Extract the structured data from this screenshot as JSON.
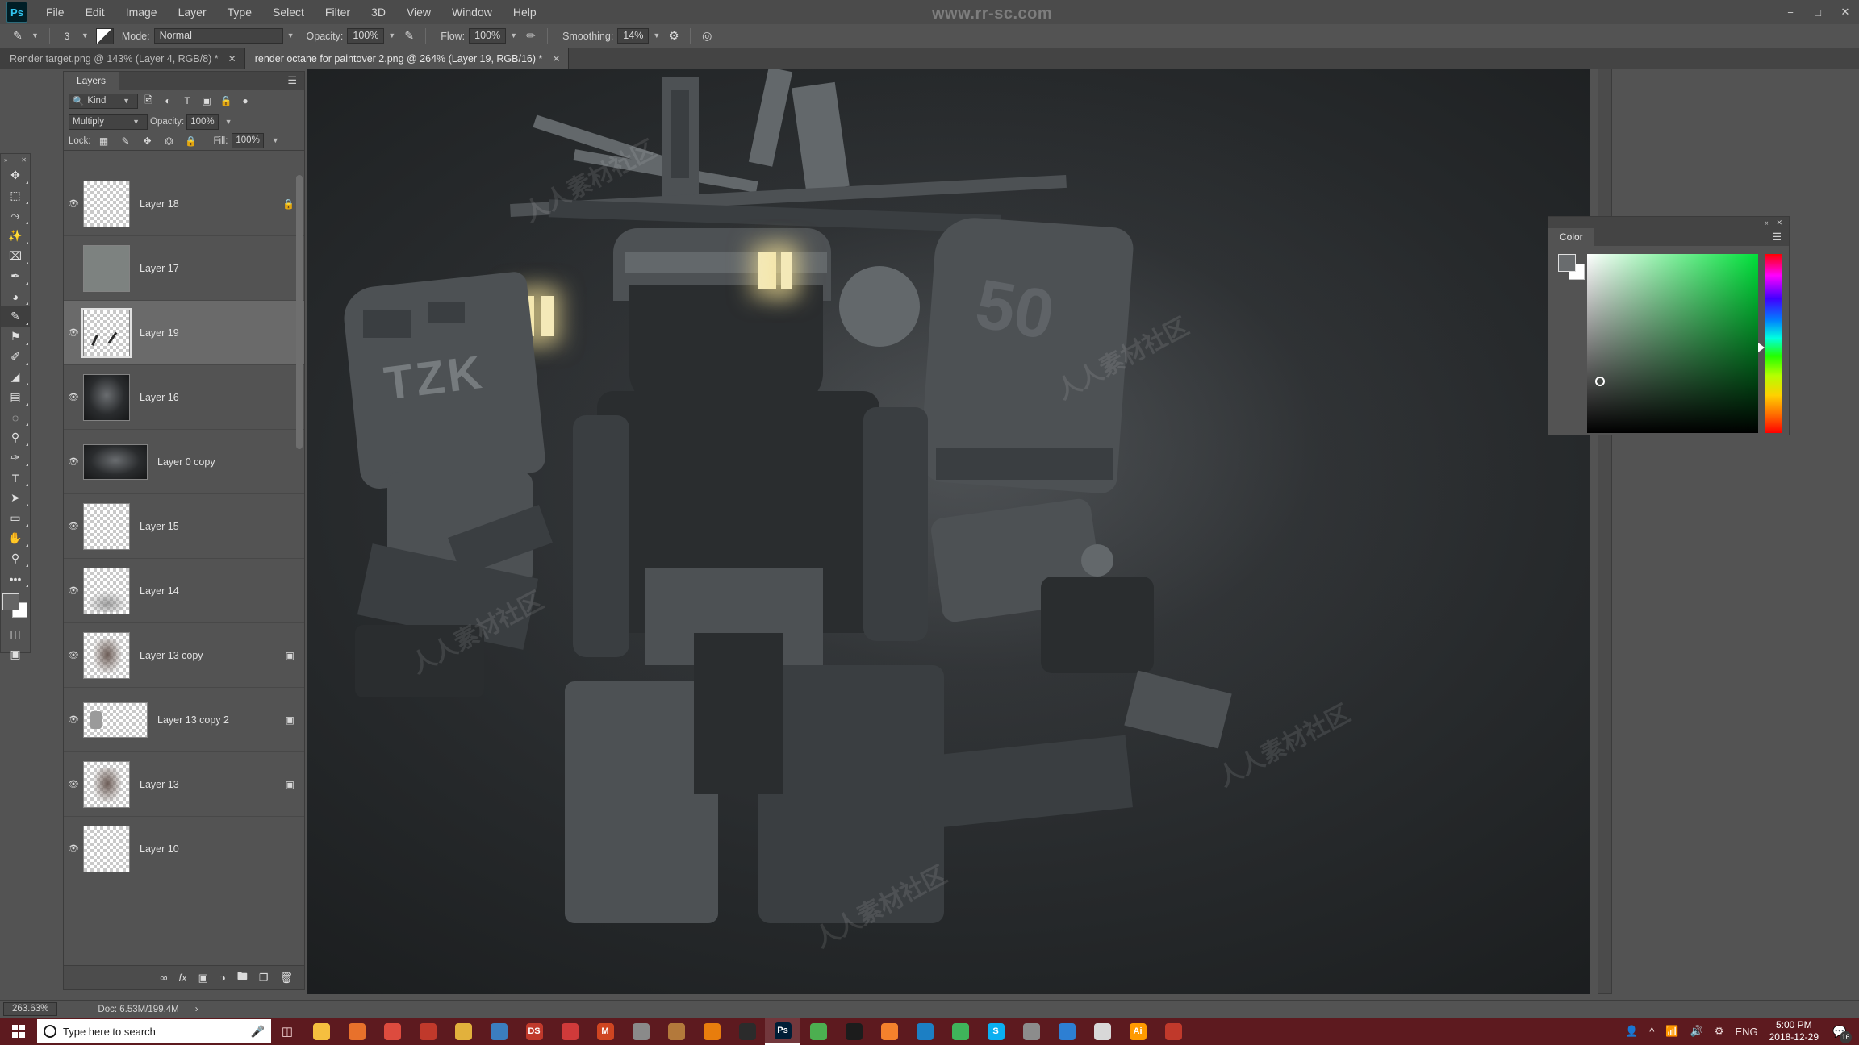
{
  "app": {
    "logo": "Ps",
    "watermark_top": "www.rr-sc.com",
    "watermark_tile": "人人素材社区"
  },
  "menu": {
    "items": [
      "File",
      "Edit",
      "Image",
      "Layer",
      "Type",
      "Select",
      "Filter",
      "3D",
      "View",
      "Window",
      "Help"
    ]
  },
  "window_controls": {
    "minimize": "−",
    "maximize": "□",
    "close": "✕"
  },
  "options_bar": {
    "brush_icon": "brush-icon",
    "brush_size": "3",
    "preset_picker": "brush-preset-swatch",
    "mode_label": "Mode:",
    "mode_value": "Normal",
    "opacity_label": "Opacity:",
    "opacity_value": "100%",
    "airbrush_icon": "airbrush-icon",
    "flow_label": "Flow:",
    "flow_value": "100%",
    "flow_pressure_icon": "pressure-flow-icon",
    "smoothing_label": "Smoothing:",
    "smoothing_value": "14%",
    "smoothing_gear_icon": "gear-icon",
    "symmetry_icon": "symmetry-icon",
    "tablet_pressure_icon": "tablet-pressure-icon"
  },
  "tabs": [
    {
      "label": "Render target.png @ 143% (Layer 4, RGB/8) *",
      "active": false,
      "close": "✕"
    },
    {
      "label": "render octane for paintover 2.png @ 264% (Layer 19, RGB/16) *",
      "active": true,
      "close": "✕"
    }
  ],
  "toolbar": {
    "collapse": "»",
    "close": "✕",
    "tools": [
      {
        "name": "move-tool",
        "glyph": "✥",
        "selected": false
      },
      {
        "name": "rectangular-marquee-tool",
        "glyph": "⬚",
        "selected": false
      },
      {
        "name": "lasso-tool",
        "glyph": "⤳",
        "selected": false
      },
      {
        "name": "magic-wand-tool",
        "glyph": "✨",
        "selected": false
      },
      {
        "name": "crop-tool",
        "glyph": "⌧",
        "selected": false
      },
      {
        "name": "eyedropper-tool",
        "glyph": "✒",
        "selected": false
      },
      {
        "name": "spot-healing-brush-tool",
        "glyph": "◕",
        "selected": false
      },
      {
        "name": "brush-tool",
        "glyph": "✎",
        "selected": true
      },
      {
        "name": "clone-stamp-tool",
        "glyph": "⚑",
        "selected": false
      },
      {
        "name": "history-brush-tool",
        "glyph": "✐",
        "selected": false
      },
      {
        "name": "eraser-tool",
        "glyph": "◢",
        "selected": false
      },
      {
        "name": "gradient-tool",
        "glyph": "▤",
        "selected": false
      },
      {
        "name": "blur-tool",
        "glyph": "◌",
        "selected": false
      },
      {
        "name": "dodge-tool",
        "glyph": "⚲",
        "selected": false
      },
      {
        "name": "pen-tool",
        "glyph": "✑",
        "selected": false
      },
      {
        "name": "type-tool",
        "glyph": "T",
        "selected": false
      },
      {
        "name": "path-selection-tool",
        "glyph": "➤",
        "selected": false
      },
      {
        "name": "rectangle-tool",
        "glyph": "▭",
        "selected": false
      },
      {
        "name": "hand-tool",
        "glyph": "✋",
        "selected": false
      },
      {
        "name": "zoom-tool",
        "glyph": "⚲",
        "selected": false
      },
      {
        "name": "edit-toolbar-button",
        "glyph": "•••",
        "selected": false
      }
    ],
    "quick_mask_icon": "quick-mask-icon",
    "screen_mode_icon": "screen-mode-icon",
    "swap-colors-icon": "swap-colors-icon",
    "default-colors-icon": "default-colors-icon",
    "foreground_color": "#656565",
    "background_color": "#ffffff"
  },
  "layers_panel": {
    "tab_label": "Layers",
    "menu_icon": "panel-menu-icon",
    "filter": {
      "kind_label": "Kind",
      "search_icon": "search-icon",
      "icons": [
        "pixel-filter-icon",
        "adjustment-filter-icon",
        "type-filter-icon",
        "shape-filter-icon",
        "smart-object-filter-icon"
      ],
      "toggle_icon": "filter-toggle-icon"
    },
    "blend_mode": "Multiply",
    "opacity_label": "Opacity:",
    "opacity_value": "100%",
    "lock_label": "Lock:",
    "lock_icons": [
      "lock-transparent-pixels-icon",
      "lock-image-pixels-icon",
      "lock-position-icon",
      "lock-artboard-icon",
      "lock-all-icon"
    ],
    "fill_label": "Fill:",
    "fill_value": "100%",
    "layers": [
      {
        "name": "Layer 18",
        "visible": true,
        "selected": false,
        "thumb": "checker",
        "right_icon": "lock-icon"
      },
      {
        "name": "Layer 17",
        "visible": false,
        "selected": false,
        "thumb": "solid",
        "right_icon": ""
      },
      {
        "name": "Layer 19",
        "visible": true,
        "selected": true,
        "thumb": "strokes",
        "right_icon": ""
      },
      {
        "name": "Layer 16",
        "visible": true,
        "selected": false,
        "thumb": "mech",
        "right_icon": ""
      },
      {
        "name": "Layer 0 copy",
        "visible": true,
        "selected": false,
        "thumb": "mechwide",
        "right_icon": ""
      },
      {
        "name": "Layer 15",
        "visible": true,
        "selected": false,
        "thumb": "checker",
        "right_icon": ""
      },
      {
        "name": "Layer 14",
        "visible": true,
        "selected": false,
        "thumb": "cloud",
        "right_icon": ""
      },
      {
        "name": "Layer 13 copy",
        "visible": true,
        "selected": false,
        "thumb": "texture",
        "right_icon": "smart-object-icon"
      },
      {
        "name": "Layer 13 copy 2",
        "visible": true,
        "selected": false,
        "thumb": "smallwide",
        "right_icon": "smart-object-icon"
      },
      {
        "name": "Layer 13",
        "visible": true,
        "selected": false,
        "thumb": "texture",
        "right_icon": "smart-object-icon"
      },
      {
        "name": "Layer 10",
        "visible": true,
        "selected": false,
        "thumb": "checker",
        "right_icon": ""
      }
    ],
    "footer_icons": [
      "link-layers-icon",
      "layer-style-fx-icon",
      "add-layer-mask-icon",
      "new-adjustment-layer-icon",
      "new-group-icon",
      "new-layer-icon",
      "delete-layer-icon"
    ],
    "footer_labels": [
      "∞",
      "fx",
      "▣",
      "◑",
      "▰",
      "❐",
      "Ὕ1"
    ]
  },
  "color_panel": {
    "tab_label": "Color",
    "collapse_icon": "collapse-icon",
    "close_icon": "close-icon",
    "menu_icon": "panel-menu-icon",
    "foreground_color": "#696c6e",
    "background_color": "#ffffff",
    "hue_selected": "#22ff00"
  },
  "status_bar": {
    "zoom": "263.63%",
    "doc_info": "Doc: 6.53M/199.4M",
    "arrow": "›"
  },
  "taskbar": {
    "start_icon": "windows-start-icon",
    "search_placeholder": "Type here to search",
    "mic_icon": "microphone-icon",
    "task_view_icon": "task-view-icon",
    "apps": [
      {
        "name": "file-explorer-icon",
        "color": "#f5bf3f",
        "letter": ""
      },
      {
        "name": "firefox-icon",
        "color": "#e8712b",
        "letter": ""
      },
      {
        "name": "chrome-icon",
        "color": "#dd4b3e",
        "letter": ""
      },
      {
        "name": "zbrush-icon",
        "color": "#c0392b",
        "letter": ""
      },
      {
        "name": "folder-icon",
        "color": "#e2b13c",
        "letter": ""
      },
      {
        "name": "image-viewer-icon",
        "color": "#3b7dbf",
        "letter": ""
      },
      {
        "name": "designspark-icon",
        "color": "#c0392b",
        "letter": "DS"
      },
      {
        "name": "opera-icon",
        "color": "#d03a3a",
        "letter": ""
      },
      {
        "name": "mysql-icon",
        "color": "#cf4521",
        "letter": "M"
      },
      {
        "name": "marmoset-icon",
        "color": "#8a8a8a",
        "letter": ""
      },
      {
        "name": "substance-icon",
        "color": "#b3793b",
        "letter": ""
      },
      {
        "name": "blender-icon",
        "color": "#e87d0d",
        "letter": ""
      },
      {
        "name": "unreal-icon",
        "color": "#2b2b2b",
        "letter": ""
      },
      {
        "name": "photoshop-icon",
        "color": "#001e36",
        "letter": "Ps"
      },
      {
        "name": "chrome2-icon",
        "color": "#4caf50",
        "letter": ""
      },
      {
        "name": "quixel-icon",
        "color": "#1c1c1c",
        "letter": ""
      },
      {
        "name": "houdini-icon",
        "color": "#f5812c",
        "letter": ""
      },
      {
        "name": "keyshot-icon",
        "color": "#1c7fc4",
        "letter": ""
      },
      {
        "name": "ndo-icon",
        "color": "#3fb45a",
        "letter": ""
      },
      {
        "name": "skype-icon",
        "color": "#0aaff1",
        "letter": "S"
      },
      {
        "name": "zbrush2-icon",
        "color": "#8c8c8c",
        "letter": ""
      },
      {
        "name": "edge-icon",
        "color": "#2d7fd3",
        "letter": ""
      },
      {
        "name": "notepad-icon",
        "color": "#d8d8d8",
        "letter": ""
      },
      {
        "name": "illustrator-icon",
        "color": "#ff9a00",
        "letter": "Ai"
      },
      {
        "name": "redshift-icon",
        "color": "#c0392b",
        "letter": ""
      }
    ],
    "tray": {
      "people_icon": "people-icon",
      "chevron_icon": "show-hidden-icons-icon",
      "wifi_icon": "wifi-icon",
      "volume_icon": "volume-icon",
      "network_icon": "network-icon",
      "language": "ENG",
      "time": "5:00 PM",
      "date": "2018-12-29",
      "notification_icon": "notifications-icon",
      "notification_count": "16"
    }
  },
  "canvas": {
    "decal_tzk": "TZK",
    "decal_50": "50",
    "eye_color": "#f4e9b8"
  }
}
